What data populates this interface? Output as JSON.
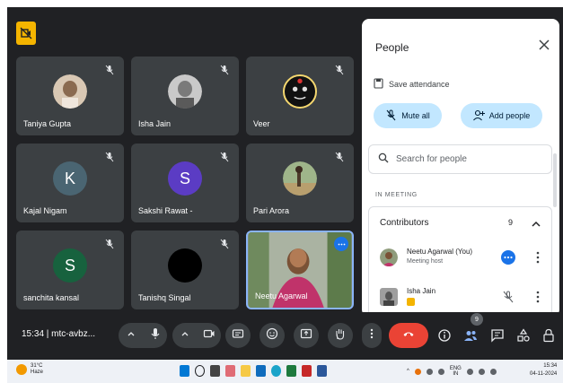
{
  "tiles": [
    {
      "name": "Taniya Gupta"
    },
    {
      "name": "Isha Jain"
    },
    {
      "name": "Veer"
    },
    {
      "name": "Kajal Nigam",
      "initial": "K"
    },
    {
      "name": "Sakshi Rawat -",
      "initial": "S"
    },
    {
      "name": "Pari Arora"
    },
    {
      "name": "sanchita kansal",
      "initial": "S"
    },
    {
      "name": "Tanishq Singal"
    },
    {
      "name": "Neetu Agarwal"
    }
  ],
  "colors": {
    "kajal_avatar": "#4a6572",
    "sakshi_avatar": "#5b3cc4",
    "sanchita_avatar": "#17623e",
    "end_call": "#ea4335",
    "accent_pill": "#c2e7ff",
    "host_badge": "#1a73e8"
  },
  "people_panel": {
    "title": "People",
    "save_attendance": "Save attendance",
    "mute_all": "Mute all",
    "add_people": "Add people",
    "search_placeholder": "Search for people",
    "section_label": "IN MEETING",
    "group_title": "Contributors",
    "group_count": "9",
    "participants": [
      {
        "name": "Neetu Agarwal (You)",
        "role": "Meeting host"
      },
      {
        "name": "Isha Jain",
        "role": ""
      }
    ]
  },
  "control_bar": {
    "time_code": "15:34  |  mtc-avbz...",
    "people_count": "9"
  },
  "taskbar": {
    "weather_temp": "31°C",
    "weather_desc": "Haze",
    "lang": "ENG",
    "lang_sub": "IN",
    "time": "15:34",
    "date": "04-11-2024"
  },
  "icons": [
    "muted-mic-icon",
    "close-icon",
    "save-attendance-icon",
    "mute-all-icon",
    "add-person-icon",
    "search-icon",
    "chevron-up-icon",
    "more-vert-icon",
    "mic-icon",
    "camera-icon",
    "captions-icon",
    "emoji-icon",
    "present-icon",
    "raise-hand-icon",
    "end-call-icon",
    "info-icon",
    "people-icon",
    "chat-icon",
    "activities-icon",
    "host-controls-icon"
  ]
}
